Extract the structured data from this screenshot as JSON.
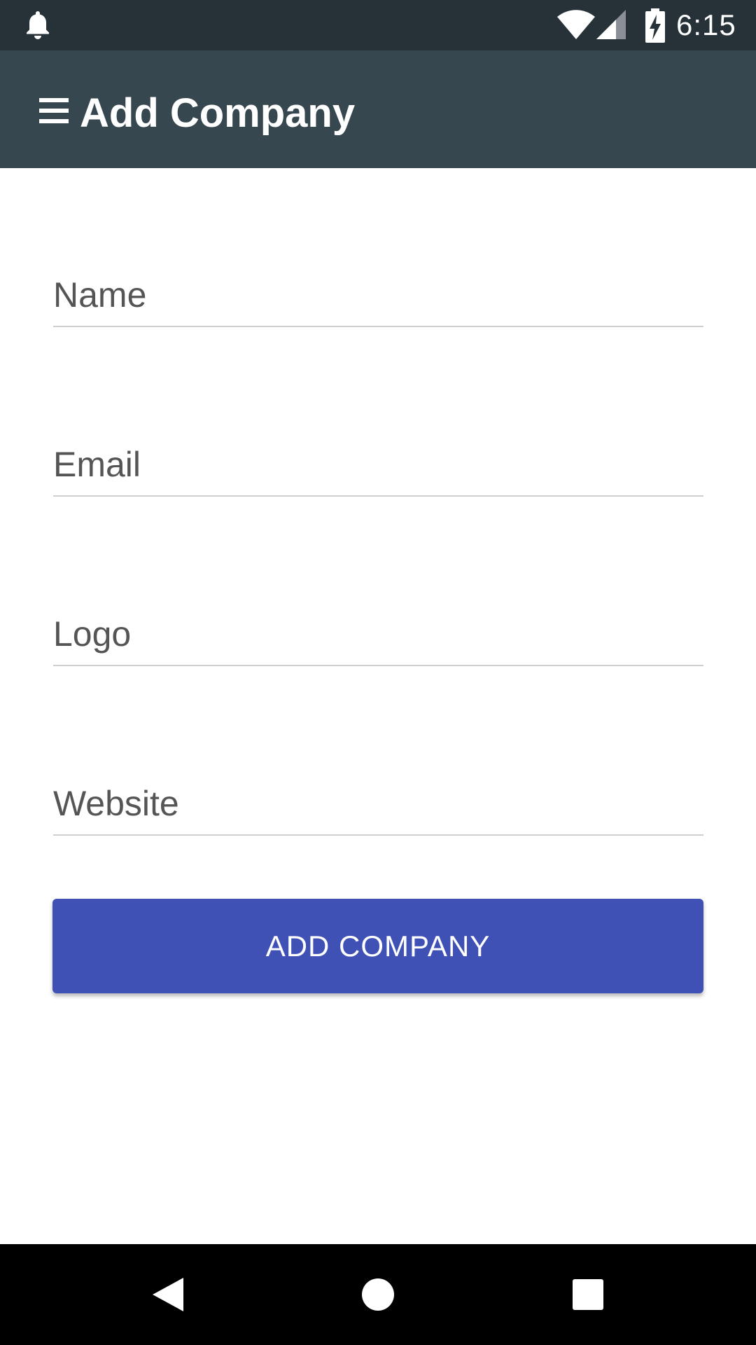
{
  "status_bar": {
    "time": "6:15",
    "icons": [
      "notification-bell-icon",
      "wifi-icon",
      "signal-icon",
      "battery-charging-icon"
    ]
  },
  "app_bar": {
    "title": "Add Company",
    "menu_icon": "hamburger-menu-icon"
  },
  "form": {
    "name_placeholder": "Name",
    "email_placeholder": "Email",
    "logo_placeholder": "Logo",
    "website_placeholder": "Website",
    "name_value": "",
    "email_value": "",
    "logo_value": "",
    "website_value": ""
  },
  "button": {
    "label": "ADD COMPANY"
  },
  "colors": {
    "status_bar": "#263238",
    "app_bar": "#37474f",
    "accent": "#3f51b5",
    "nav_bar": "#000000"
  },
  "nav_bar": {
    "icons": [
      "back-icon",
      "home-icon",
      "recent-apps-icon"
    ]
  }
}
